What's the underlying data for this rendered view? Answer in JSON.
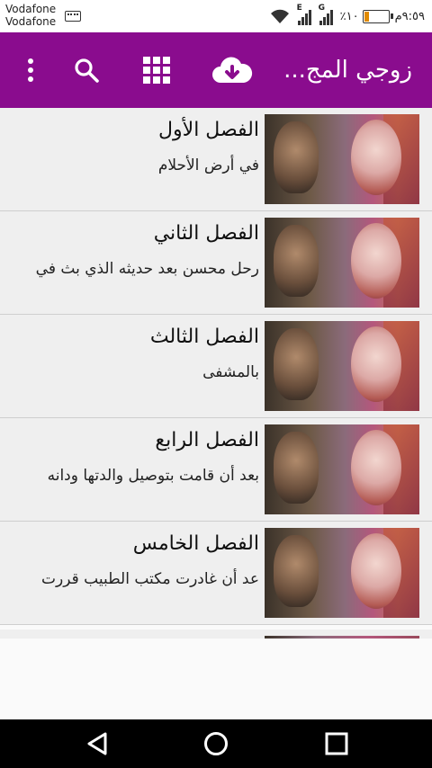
{
  "status_bar": {
    "carrier_1": "Vodafone",
    "carrier_2": "Vodafone",
    "network_1": "E",
    "network_2": "G",
    "battery_percent": "٪١٠",
    "time": "٩:٥٩م"
  },
  "app_bar": {
    "title": "زوجي المج...",
    "color": "#8a0c8e",
    "icons": [
      "download-icon",
      "grid-icon",
      "search-icon",
      "overflow-menu-icon"
    ]
  },
  "chapters": [
    {
      "title": "الفصل الأول",
      "excerpt": "في أرض الأحلام"
    },
    {
      "title": "الفصل الثاني",
      "excerpt": "رحل محسن بعد حديثه الذي بث في"
    },
    {
      "title": "الفصل الثالث",
      "excerpt": "بالمشفى"
    },
    {
      "title": "الفصل الرابع",
      "excerpt": "بعد أن قامت بتوصيل والدتها ودانه"
    },
    {
      "title": "الفصل الخامس",
      "excerpt": "عد أن غادرت مكتب الطبيب قررت"
    }
  ],
  "nav_bar": {
    "icons": [
      "back-icon",
      "home-icon",
      "recents-icon"
    ]
  }
}
